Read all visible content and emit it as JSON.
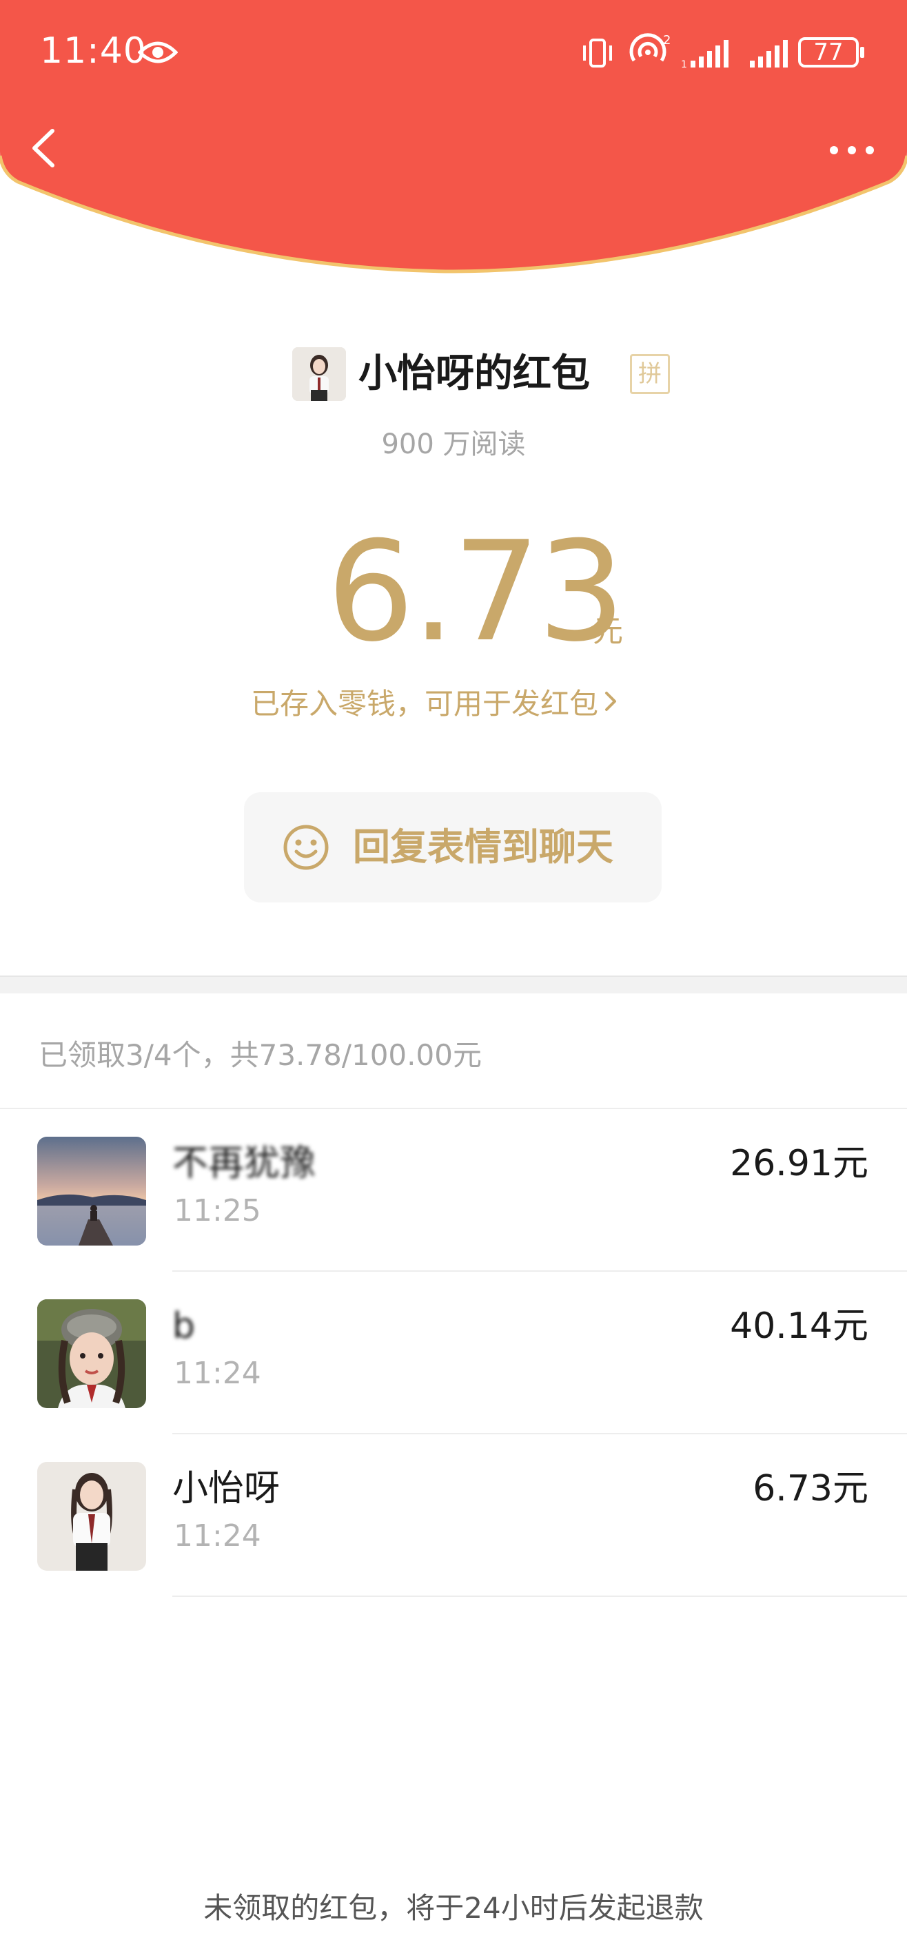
{
  "status": {
    "time": "11:40",
    "battery": "77"
  },
  "header": {
    "accent": "#f45649",
    "rim": "#f2c46c"
  },
  "packet": {
    "sender": "小怡呀的红包",
    "badge": "拼",
    "reads": "900 万阅读",
    "amount": "6.73",
    "unit": "元",
    "stored_note": "已存入零钱，可用于发红包",
    "reply_label": "回复表情到聊天",
    "gold": "#c9a86a"
  },
  "summary": "已领取3/4个，共73.78/100.00元",
  "claims": [
    {
      "name": "不再犹豫",
      "time": "11:25",
      "amount": "26.91元",
      "blurred": true
    },
    {
      "name": "b",
      "time": "11:24",
      "amount": "40.14元",
      "blurred": true
    },
    {
      "name": "小怡呀",
      "time": "11:24",
      "amount": "6.73元",
      "blurred": false
    }
  ],
  "footer": "未领取的红包，将于24小时后发起退款"
}
